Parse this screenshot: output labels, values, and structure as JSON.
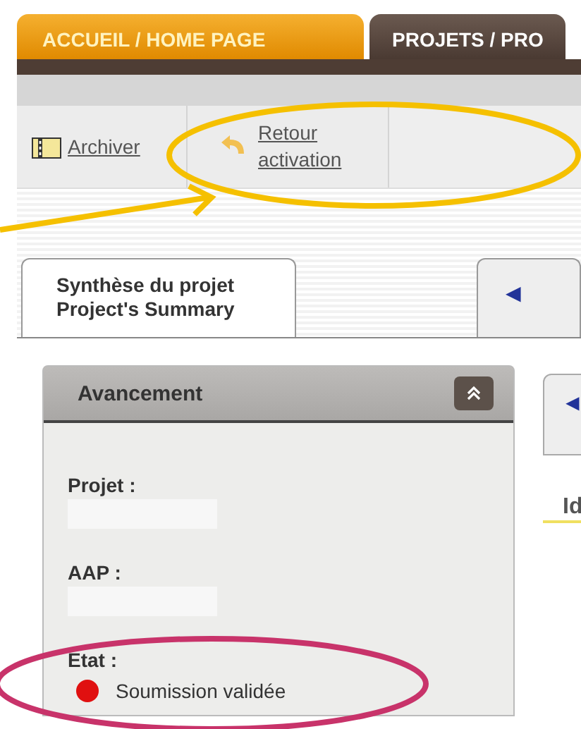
{
  "nav_tabs": [
    {
      "label": "ACCUEIL / HOME PAGE",
      "selected": true
    },
    {
      "label": "PROJETS / PRO",
      "selected": false
    }
  ],
  "toolbar": [
    {
      "kind": "archive",
      "label": "Archiver"
    },
    {
      "kind": "undo",
      "label": "Retour activation"
    }
  ],
  "project_tabs": [
    {
      "label": "Synthèse du projet Project's Summary",
      "selected": true
    },
    {
      "label": "◄",
      "selected": false
    }
  ],
  "panel": {
    "title": "Avancement",
    "fields": [
      {
        "label": "Projet :"
      },
      {
        "label": "AAP :"
      }
    ],
    "state": {
      "label": "Etat :",
      "text": "Soumission validée",
      "color": "#e01010"
    }
  },
  "detail": {
    "tab_glyph": "◄",
    "heading": "Id"
  }
}
